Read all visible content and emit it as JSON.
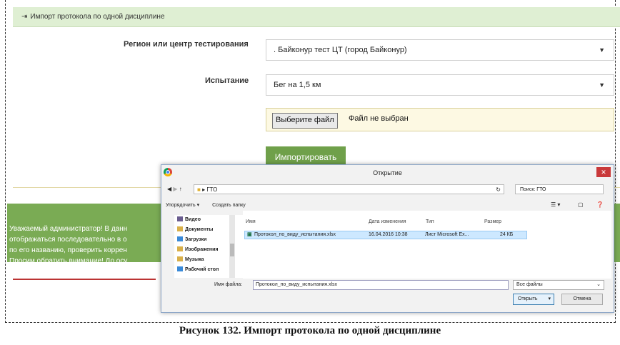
{
  "header": {
    "title": "Импорт протокола по одной дисциплине"
  },
  "form": {
    "region_label": "Регион или центр тестирования",
    "region_value": ". Байконур тест ЦТ (город Байконур)",
    "test_label": "Испытание",
    "test_value": "Бег на 1,5 км",
    "file_button": "Выберите файл",
    "file_status": "Файл не выбран",
    "import_button": "Импортировать"
  },
  "banner": {
    "lines": [
      "Уважаемый администратор! В данн",
      "отображаться последовательно в о",
      "по его названию, проверить коррен",
      "Просим обратить внимание! До осу"
    ],
    "color": "#7aab54"
  },
  "dialog": {
    "title": "Открытие",
    "close": "✕",
    "path": "ГТО",
    "search_placeholder": "Поиск: ГТО",
    "organize": "Упорядочить ▾",
    "new_folder": "Создать папку",
    "sidebar": [
      "Видео",
      "Документы",
      "Загрузки",
      "Изображения",
      "Музыка",
      "Рабочий стол"
    ],
    "columns": {
      "name": "Имя",
      "date": "Дата изменения",
      "type": "Тип",
      "size": "Размер"
    },
    "file": {
      "name": "Протокол_по_виду_испытания.xlsx",
      "date": "16.04.2016 10:38",
      "type": "Лист Microsoft Ex...",
      "size": "24 КБ"
    },
    "filename_label": "Имя файла:",
    "filename_value": "Протокол_по_виду_испытания.xlsx",
    "filetype": "Все файлы",
    "open_button": "Открыть",
    "cancel_button": "Отмена"
  },
  "caption": "Рисунок 132. Импорт протокола по одной дисциплине"
}
